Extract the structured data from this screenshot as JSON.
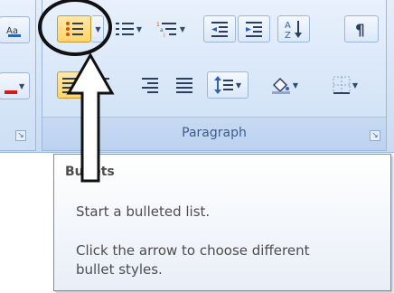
{
  "ribbon": {
    "paragraph_group": {
      "label": "Paragraph",
      "row1": [
        "bullets",
        "numbering",
        "multilevel-list",
        "decrease-indent",
        "increase-indent",
        "sort",
        "show-hide"
      ],
      "row2": [
        "align-left",
        "center",
        "align-right",
        "justify",
        "line-spacing",
        "shading",
        "borders"
      ]
    },
    "left_group": {
      "partial": true
    }
  },
  "tooltip": {
    "title": "Bullets",
    "description": "Start a bulleted list.",
    "hint_line1": "Click the arrow to choose different",
    "hint_line2": "bullet styles."
  },
  "annotation": {
    "circle_color": "#111111",
    "arrow_color": "#111111"
  },
  "colors": {
    "active_button": "#ffd46b",
    "group_label": "#3d5c8d",
    "tooltip_text": "#4c4c4c"
  }
}
